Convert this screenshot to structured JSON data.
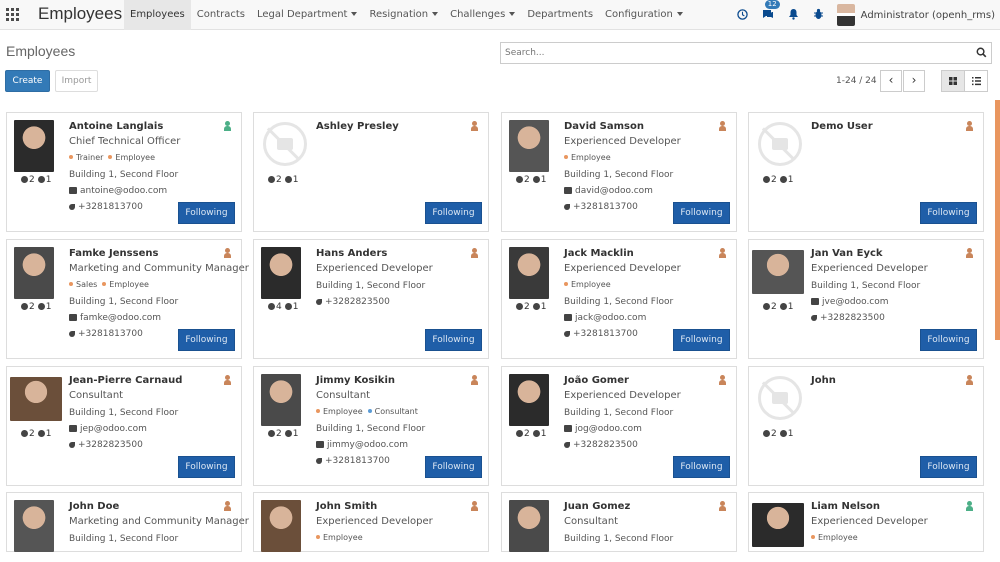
{
  "navbar": {
    "brand": "Employees",
    "menu": [
      {
        "label": "Employees",
        "active": true,
        "dropdown": false
      },
      {
        "label": "Contracts",
        "active": false,
        "dropdown": false
      },
      {
        "label": "Legal Department",
        "active": false,
        "dropdown": true
      },
      {
        "label": "Resignation",
        "active": false,
        "dropdown": true
      },
      {
        "label": "Challenges",
        "active": false,
        "dropdown": true
      },
      {
        "label": "Departments",
        "active": false,
        "dropdown": false
      },
      {
        "label": "Configuration",
        "active": false,
        "dropdown": true
      }
    ],
    "systray": {
      "message_count": "12",
      "user": "Administrator (openh_rms)"
    }
  },
  "control_panel": {
    "title": "Employees",
    "search_placeholder": "Search...",
    "create_label": "Create",
    "import_label": "Import",
    "pager": "1-24 / 24",
    "prev": "‹",
    "next": "›"
  },
  "colors": {
    "primary": "#337ab7",
    "follow": "#1f5ea8",
    "status_present": "#4caf87",
    "status_absent": "#c9855a",
    "scroll_accent": "#e9965f"
  },
  "employees": [
    {
      "name": "Antoine Langlais",
      "job": "Chief Technical Officer",
      "tags": [
        {
          "label": "Trainer",
          "color": "#e9965f"
        },
        {
          "label": "Employee",
          "color": "#e9965f"
        }
      ],
      "location": "Building 1, Second Floor",
      "email": "antoine@odoo.com",
      "phone": "+3281813700",
      "messages": "2",
      "followers": "1",
      "status": "present",
      "follow": "Following",
      "photo": "photo"
    },
    {
      "name": "Ashley Presley",
      "job": "",
      "tags": [],
      "location": "",
      "email": "",
      "phone": "",
      "messages": "2",
      "followers": "1",
      "status": "absent",
      "follow": "Following",
      "photo": "placeholder"
    },
    {
      "name": "David Samson",
      "job": "Experienced Developer",
      "tags": [
        {
          "label": "Employee",
          "color": "#e9965f"
        }
      ],
      "location": "Building 1, Second Floor",
      "email": "david@odoo.com",
      "phone": "+3281813700",
      "messages": "2",
      "followers": "1",
      "status": "absent",
      "follow": "Following",
      "photo": "photo"
    },
    {
      "name": "Demo User",
      "job": "",
      "tags": [],
      "location": "",
      "email": "",
      "phone": "",
      "messages": "2",
      "followers": "1",
      "status": "absent",
      "follow": "Following",
      "photo": "placeholder"
    },
    {
      "name": "Famke Jenssens",
      "job": "Marketing and Community Manager",
      "tags": [
        {
          "label": "Sales",
          "color": "#e9965f"
        },
        {
          "label": "Employee",
          "color": "#e9965f"
        }
      ],
      "location": "Building 1, Second Floor",
      "email": "famke@odoo.com",
      "phone": "+3281813700",
      "messages": "2",
      "followers": "1",
      "status": "absent",
      "follow": "Following",
      "photo": "photo"
    },
    {
      "name": "Hans Anders",
      "job": "Experienced Developer",
      "tags": [],
      "location": "Building 1, Second Floor",
      "email": "",
      "phone": "+3282823500",
      "messages": "4",
      "followers": "1",
      "status": "absent",
      "follow": "Following",
      "photo": "photo"
    },
    {
      "name": "Jack Macklin",
      "job": "Experienced Developer",
      "tags": [
        {
          "label": "Employee",
          "color": "#e9965f"
        }
      ],
      "location": "Building 1, Second Floor",
      "email": "jack@odoo.com",
      "phone": "+3281813700",
      "messages": "2",
      "followers": "1",
      "status": "absent",
      "follow": "Following",
      "photo": "photo"
    },
    {
      "name": "Jan Van Eyck",
      "job": "Experienced Developer",
      "tags": [],
      "location": "Building 1, Second Floor",
      "email": "jve@odoo.com",
      "phone": "+3282823500",
      "messages": "2",
      "followers": "1",
      "status": "absent",
      "follow": "Following",
      "photo": "photo-wide"
    },
    {
      "name": "Jean-Pierre Carnaud",
      "job": "Consultant",
      "tags": [],
      "location": "Building 1, Second Floor",
      "email": "jep@odoo.com",
      "phone": "+3282823500",
      "messages": "2",
      "followers": "1",
      "status": "absent",
      "follow": "Following",
      "photo": "photo-wide"
    },
    {
      "name": "Jimmy Kosikin",
      "job": "Consultant",
      "tags": [
        {
          "label": "Employee",
          "color": "#e9965f"
        },
        {
          "label": "Consultant",
          "color": "#5b9bd5"
        }
      ],
      "location": "Building 1, Second Floor",
      "email": "jimmy@odoo.com",
      "phone": "+3281813700",
      "messages": "2",
      "followers": "1",
      "status": "absent",
      "follow": "Following",
      "photo": "photo"
    },
    {
      "name": "João Gomer",
      "job": "Experienced Developer",
      "tags": [],
      "location": "Building 1, Second Floor",
      "email": "jog@odoo.com",
      "phone": "+3282823500",
      "messages": "2",
      "followers": "1",
      "status": "absent",
      "follow": "Following",
      "photo": "photo"
    },
    {
      "name": "John",
      "job": "",
      "tags": [],
      "location": "",
      "email": "",
      "phone": "",
      "messages": "2",
      "followers": "1",
      "status": "absent",
      "follow": "Following",
      "photo": "placeholder"
    },
    {
      "name": "John Doe",
      "job": "Marketing and Community Manager",
      "tags": [],
      "location": "Building 1, Second Floor",
      "email": "",
      "phone": "",
      "messages": "",
      "followers": "",
      "status": "absent",
      "follow": "",
      "photo": "photo"
    },
    {
      "name": "John Smith",
      "job": "Experienced Developer",
      "tags": [
        {
          "label": "Employee",
          "color": "#e9965f"
        }
      ],
      "location": "",
      "email": "",
      "phone": "",
      "messages": "",
      "followers": "",
      "status": "absent",
      "follow": "",
      "photo": "photo"
    },
    {
      "name": "Juan Gomez",
      "job": "Consultant",
      "tags": [],
      "location": "Building 1, Second Floor",
      "email": "",
      "phone": "",
      "messages": "",
      "followers": "",
      "status": "absent",
      "follow": "",
      "photo": "photo"
    },
    {
      "name": "Liam Nelson",
      "job": "Experienced Developer",
      "tags": [
        {
          "label": "Employee",
          "color": "#e9965f"
        }
      ],
      "location": "",
      "email": "",
      "phone": "",
      "messages": "",
      "followers": "",
      "status": "present",
      "follow": "",
      "photo": "photo-wide"
    }
  ]
}
